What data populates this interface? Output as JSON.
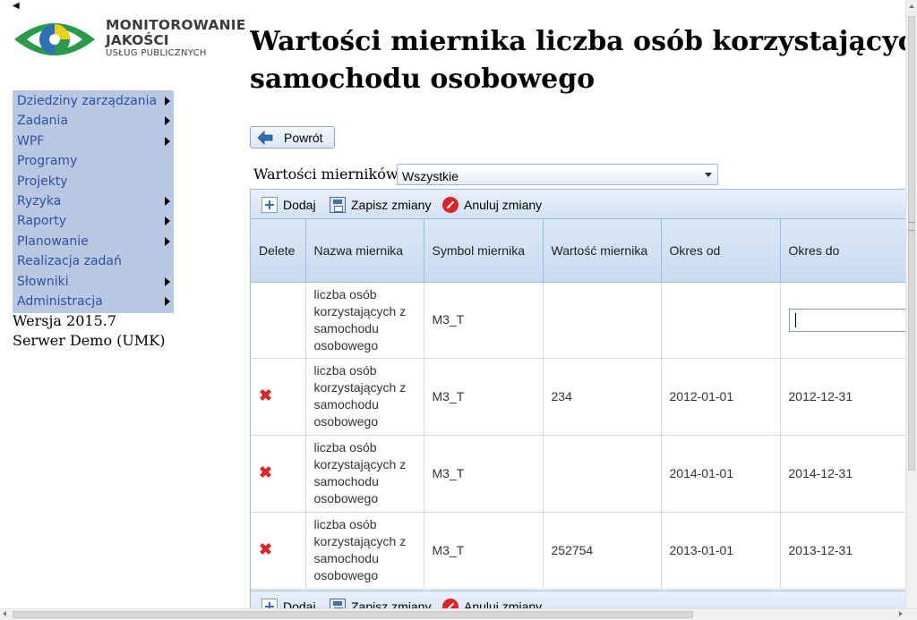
{
  "logo": {
    "line1": "MONITOROWANIE",
    "line2": "JAKOŚCI",
    "line3": "USŁUG PUBLICZNYCH",
    "colors": {
      "green": "#2b9a4a",
      "blue": "#2f6fb3",
      "yellow": "#e9d21b"
    }
  },
  "sidebar": {
    "items": [
      {
        "label": "Dziedziny zarządzania",
        "submenu": true
      },
      {
        "label": "Zadania",
        "submenu": true
      },
      {
        "label": "WPF",
        "submenu": true
      },
      {
        "label": "Programy",
        "submenu": false
      },
      {
        "label": "Projekty",
        "submenu": false
      },
      {
        "label": "Ryzyka",
        "submenu": true
      },
      {
        "label": "Raporty",
        "submenu": true
      },
      {
        "label": "Planowanie",
        "submenu": true
      },
      {
        "label": "Realizacja zadań",
        "submenu": false
      },
      {
        "label": "Słowniki",
        "submenu": true
      },
      {
        "label": "Administracja",
        "submenu": true
      }
    ]
  },
  "footer": {
    "version": "Wersja 2015.7",
    "server": "Serwer Demo (UMK)"
  },
  "page": {
    "title_line1": "Wartości miernika liczba osób korzystającyc",
    "title_line2": "samochodu osobowego"
  },
  "back_button": {
    "label": "Powrót"
  },
  "filter": {
    "label": "Wartości mierników",
    "selected": "Wszystkie"
  },
  "toolbar": {
    "add_label": "Dodaj",
    "save_label": "Zapisz zmiany",
    "cancel_label": "Anuluj zmiany"
  },
  "table": {
    "headers": {
      "delete": "Delete",
      "name": "Nazwa miernika",
      "symbol": "Symbol miernika",
      "value": "Wartość miernika",
      "from": "Okres od",
      "to": "Okres do"
    },
    "rows": [
      {
        "name": "liczba osób korzystających z samochodu osobowego",
        "symbol": "M3_T",
        "value": "",
        "from": "",
        "to": "",
        "editing": true
      },
      {
        "name": "liczba osób korzystających z samochodu osobowego",
        "symbol": "M3_T",
        "value": "234",
        "from": "2012-01-01",
        "to": "2012-12-31"
      },
      {
        "name": "liczba osób korzystających z samochodu osobowego",
        "symbol": "M3_T",
        "value": "",
        "from": "2014-01-01",
        "to": "2014-12-31"
      },
      {
        "name": "liczba osób korzystających z samochodu osobowego",
        "symbol": "M3_T",
        "value": "252754",
        "from": "2013-01-01",
        "to": "2013-12-31"
      }
    ]
  }
}
